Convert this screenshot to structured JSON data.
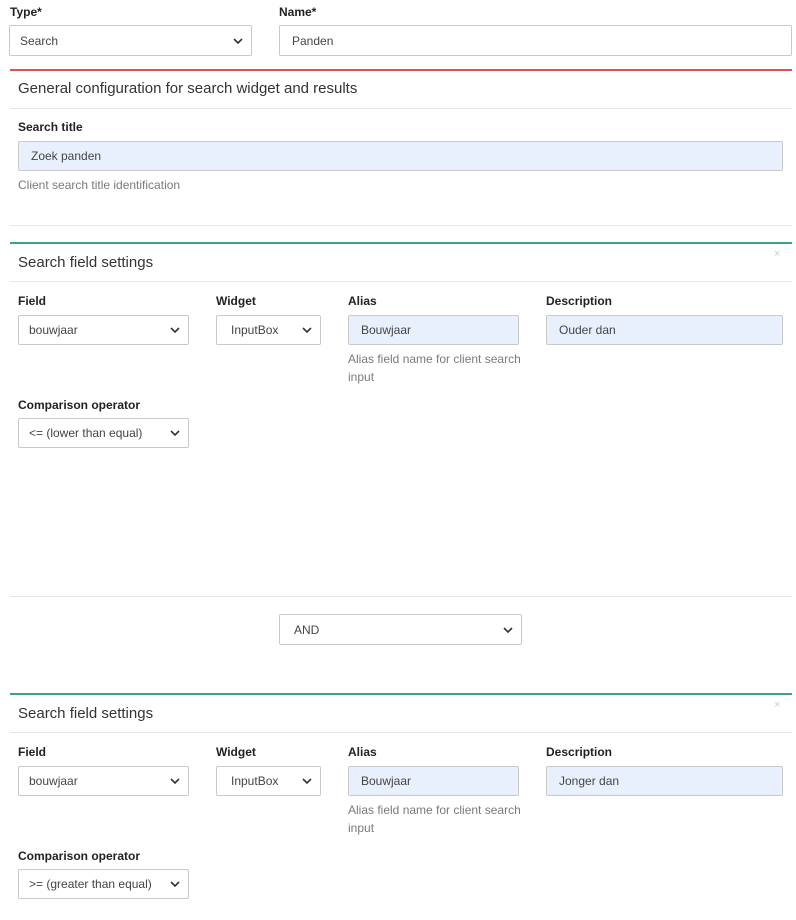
{
  "top": {
    "type_label": "Type*",
    "type_value": "Search",
    "name_label": "Name*",
    "name_value": "Panden"
  },
  "general": {
    "title": "General configuration for search widget and results",
    "search_title_label": "Search title",
    "search_title_value": "Zoek panden",
    "search_title_help": "Client search title identification",
    "accent_color": "#d9534f"
  },
  "field_panels": [
    {
      "title": "Search field settings",
      "close": "×",
      "field_label": "Field",
      "field_value": "bouwjaar",
      "widget_label": "Widget",
      "widget_value": "InputBox",
      "alias_label": "Alias",
      "alias_value": "Bouwjaar",
      "alias_help": "Alias field name for client search input",
      "description_label": "Description",
      "description_value": "Ouder dan",
      "operator_label": "Comparison operator",
      "operator_value": "<= (lower than equal)"
    },
    {
      "title": "Search field settings",
      "close": "×",
      "field_label": "Field",
      "field_value": "bouwjaar",
      "widget_label": "Widget",
      "widget_value": "InputBox",
      "alias_label": "Alias",
      "alias_value": "Bouwjaar",
      "alias_help": "Alias field name for client search input",
      "description_label": "Description",
      "description_value": "Jonger dan",
      "operator_label": "Comparison operator",
      "operator_value": ">= (greater than equal)"
    }
  ],
  "connector": {
    "value": "AND"
  },
  "colors": {
    "field_panel_accent": "#3aa57a",
    "filled_input_bg": "#e8f0fe"
  }
}
